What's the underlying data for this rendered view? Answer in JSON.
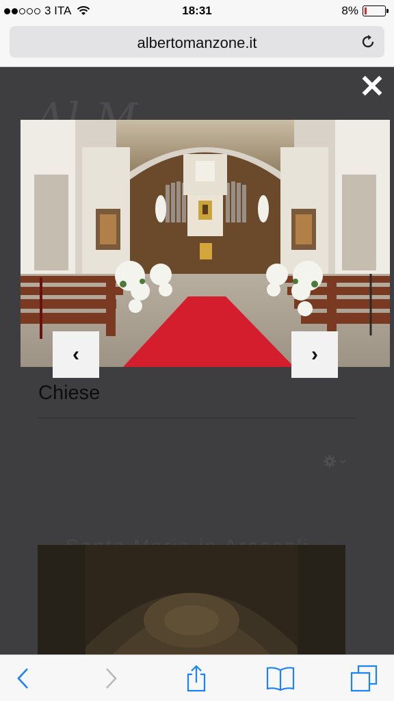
{
  "status_bar": {
    "carrier": "3 ITA",
    "time": "18:31",
    "battery": "8%",
    "battery_level": 0.08
  },
  "url_bar": {
    "domain": "albertomanzone.it",
    "icon": "reload-icon"
  },
  "lightbox": {
    "close_label": "✕",
    "prev_label": "‹",
    "next_label": "›",
    "photo_icon": "church-interior-photo"
  },
  "page": {
    "caption": "Chiese",
    "faded_title": "Santa Maria in Aracoeli"
  },
  "toolbar": {
    "items": [
      "back-icon",
      "forward-icon",
      "share-icon",
      "bookmarks-icon",
      "tabs-icon"
    ]
  },
  "colors": {
    "accent": "#1a82fb",
    "overlay": "#3e3e40",
    "battery_low": "#e0262b"
  }
}
